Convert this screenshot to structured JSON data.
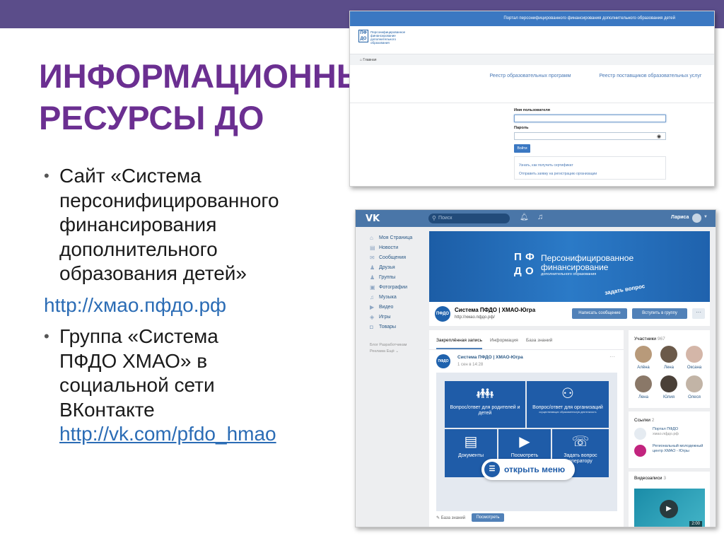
{
  "slide": {
    "title_line1": "ИНФОРМАЦИОННЫЕ",
    "title_line2": "РЕСУРСЫ ДО",
    "bullet1_lines": [
      "Сайт «Система",
      "персонифицированного",
      "финансирования",
      "дополнительного",
      "образования детей»"
    ],
    "link1": "http://хмао.пфдо.рф",
    "bullet2_lines": [
      "Группа  «Система",
      "ПФДО ХМАО» в",
      "социальной сети",
      "ВКонтакте"
    ],
    "link2": "http://vk.com/pfdo_hmao"
  },
  "portal": {
    "header": "Портал персонифицированного финансирования дополнительного образования детей",
    "logo_letters": "ПФ ДО",
    "logo_text": "Персонифицированное финансирование дополнительного образования",
    "breadcrumb": "Главная",
    "nav1": "Реестр образовательных программ",
    "nav2": "Реестр поставщиков образовательных услуг",
    "username_label": "Имя пользователя",
    "password_label": "Пароль",
    "login_button": "Войти",
    "cert_link": "Узнать, как получить сертификат",
    "register_link": "Отправить заявку на регистрацию организации"
  },
  "vk": {
    "logo": "VK",
    "search_placeholder": "Поиск",
    "user_name": "Лариса",
    "menu": [
      {
        "icon": "⌂",
        "label": "Моя Страница"
      },
      {
        "icon": "▤",
        "label": "Новости"
      },
      {
        "icon": "✉",
        "label": "Сообщения"
      },
      {
        "icon": "♟",
        "label": "Друзья"
      },
      {
        "icon": "♟",
        "label": "Группы"
      },
      {
        "icon": "▣",
        "label": "Фотографии"
      },
      {
        "icon": "♫",
        "label": "Музыка"
      },
      {
        "icon": "▶",
        "label": "Видео"
      },
      {
        "icon": "◈",
        "label": "Игры"
      },
      {
        "icon": "◘",
        "label": "Товары"
      }
    ],
    "footer_line1": "Блог  Разработчикам",
    "footer_line2": "Реклама  Ещё ⌄",
    "cover_letters": [
      "П",
      "Ф",
      "Д",
      "О"
    ],
    "cover_title1": "Персонифицированное",
    "cover_title2": "финансирование",
    "cover_sub": "дополнительного образования",
    "cover_ask": "задать вопрос",
    "group_name": "Система ПФДО | ХМАО-Югра",
    "group_url": "http://хмао.пфдо.рф/",
    "btn_message": "Написать сообщение",
    "btn_join": "Вступить в группу",
    "btn_more": "···",
    "tabs": [
      "Закреплённая запись",
      "Информация",
      "База знаний"
    ],
    "post_author": "Система ПФДО | ХМАО-Югра",
    "post_date": "1 сен в 14:28",
    "tiles": [
      {
        "label": "Вопрос/ответ для родителей и детей",
        "small": ""
      },
      {
        "label": "Вопрос/ответ для организаций",
        "small": "осуществляющих образовательную деятельность"
      },
      {
        "label": "Документы",
        "small": ""
      },
      {
        "label": "Посмотреть",
        "small": ""
      },
      {
        "label": "Задать вопрос оператору",
        "small": ""
      }
    ],
    "open_menu": "открыть меню",
    "wall_foot_label": "База знаний",
    "wall_foot_button": "Посмотреть",
    "members_title": "Участники",
    "members_count": "967",
    "members": [
      "Алёна",
      "Лена",
      "Оксана",
      "Лена",
      "Юлия",
      "Олеся"
    ],
    "links_title": "Ссылки",
    "links_count": "2",
    "links": [
      {
        "title": "Портал ПФДО",
        "sub": "хмао.пфдо.рф"
      },
      {
        "title": "Региональный молодежный центр ХМАО - Югры",
        "sub": ""
      }
    ],
    "videos_title": "Видеозаписи",
    "videos_count": "3",
    "video_duration": "2:00",
    "colors": {
      "header": "#4a76a8",
      "accent": "#5181b8",
      "cover": "#1f62ad"
    }
  }
}
